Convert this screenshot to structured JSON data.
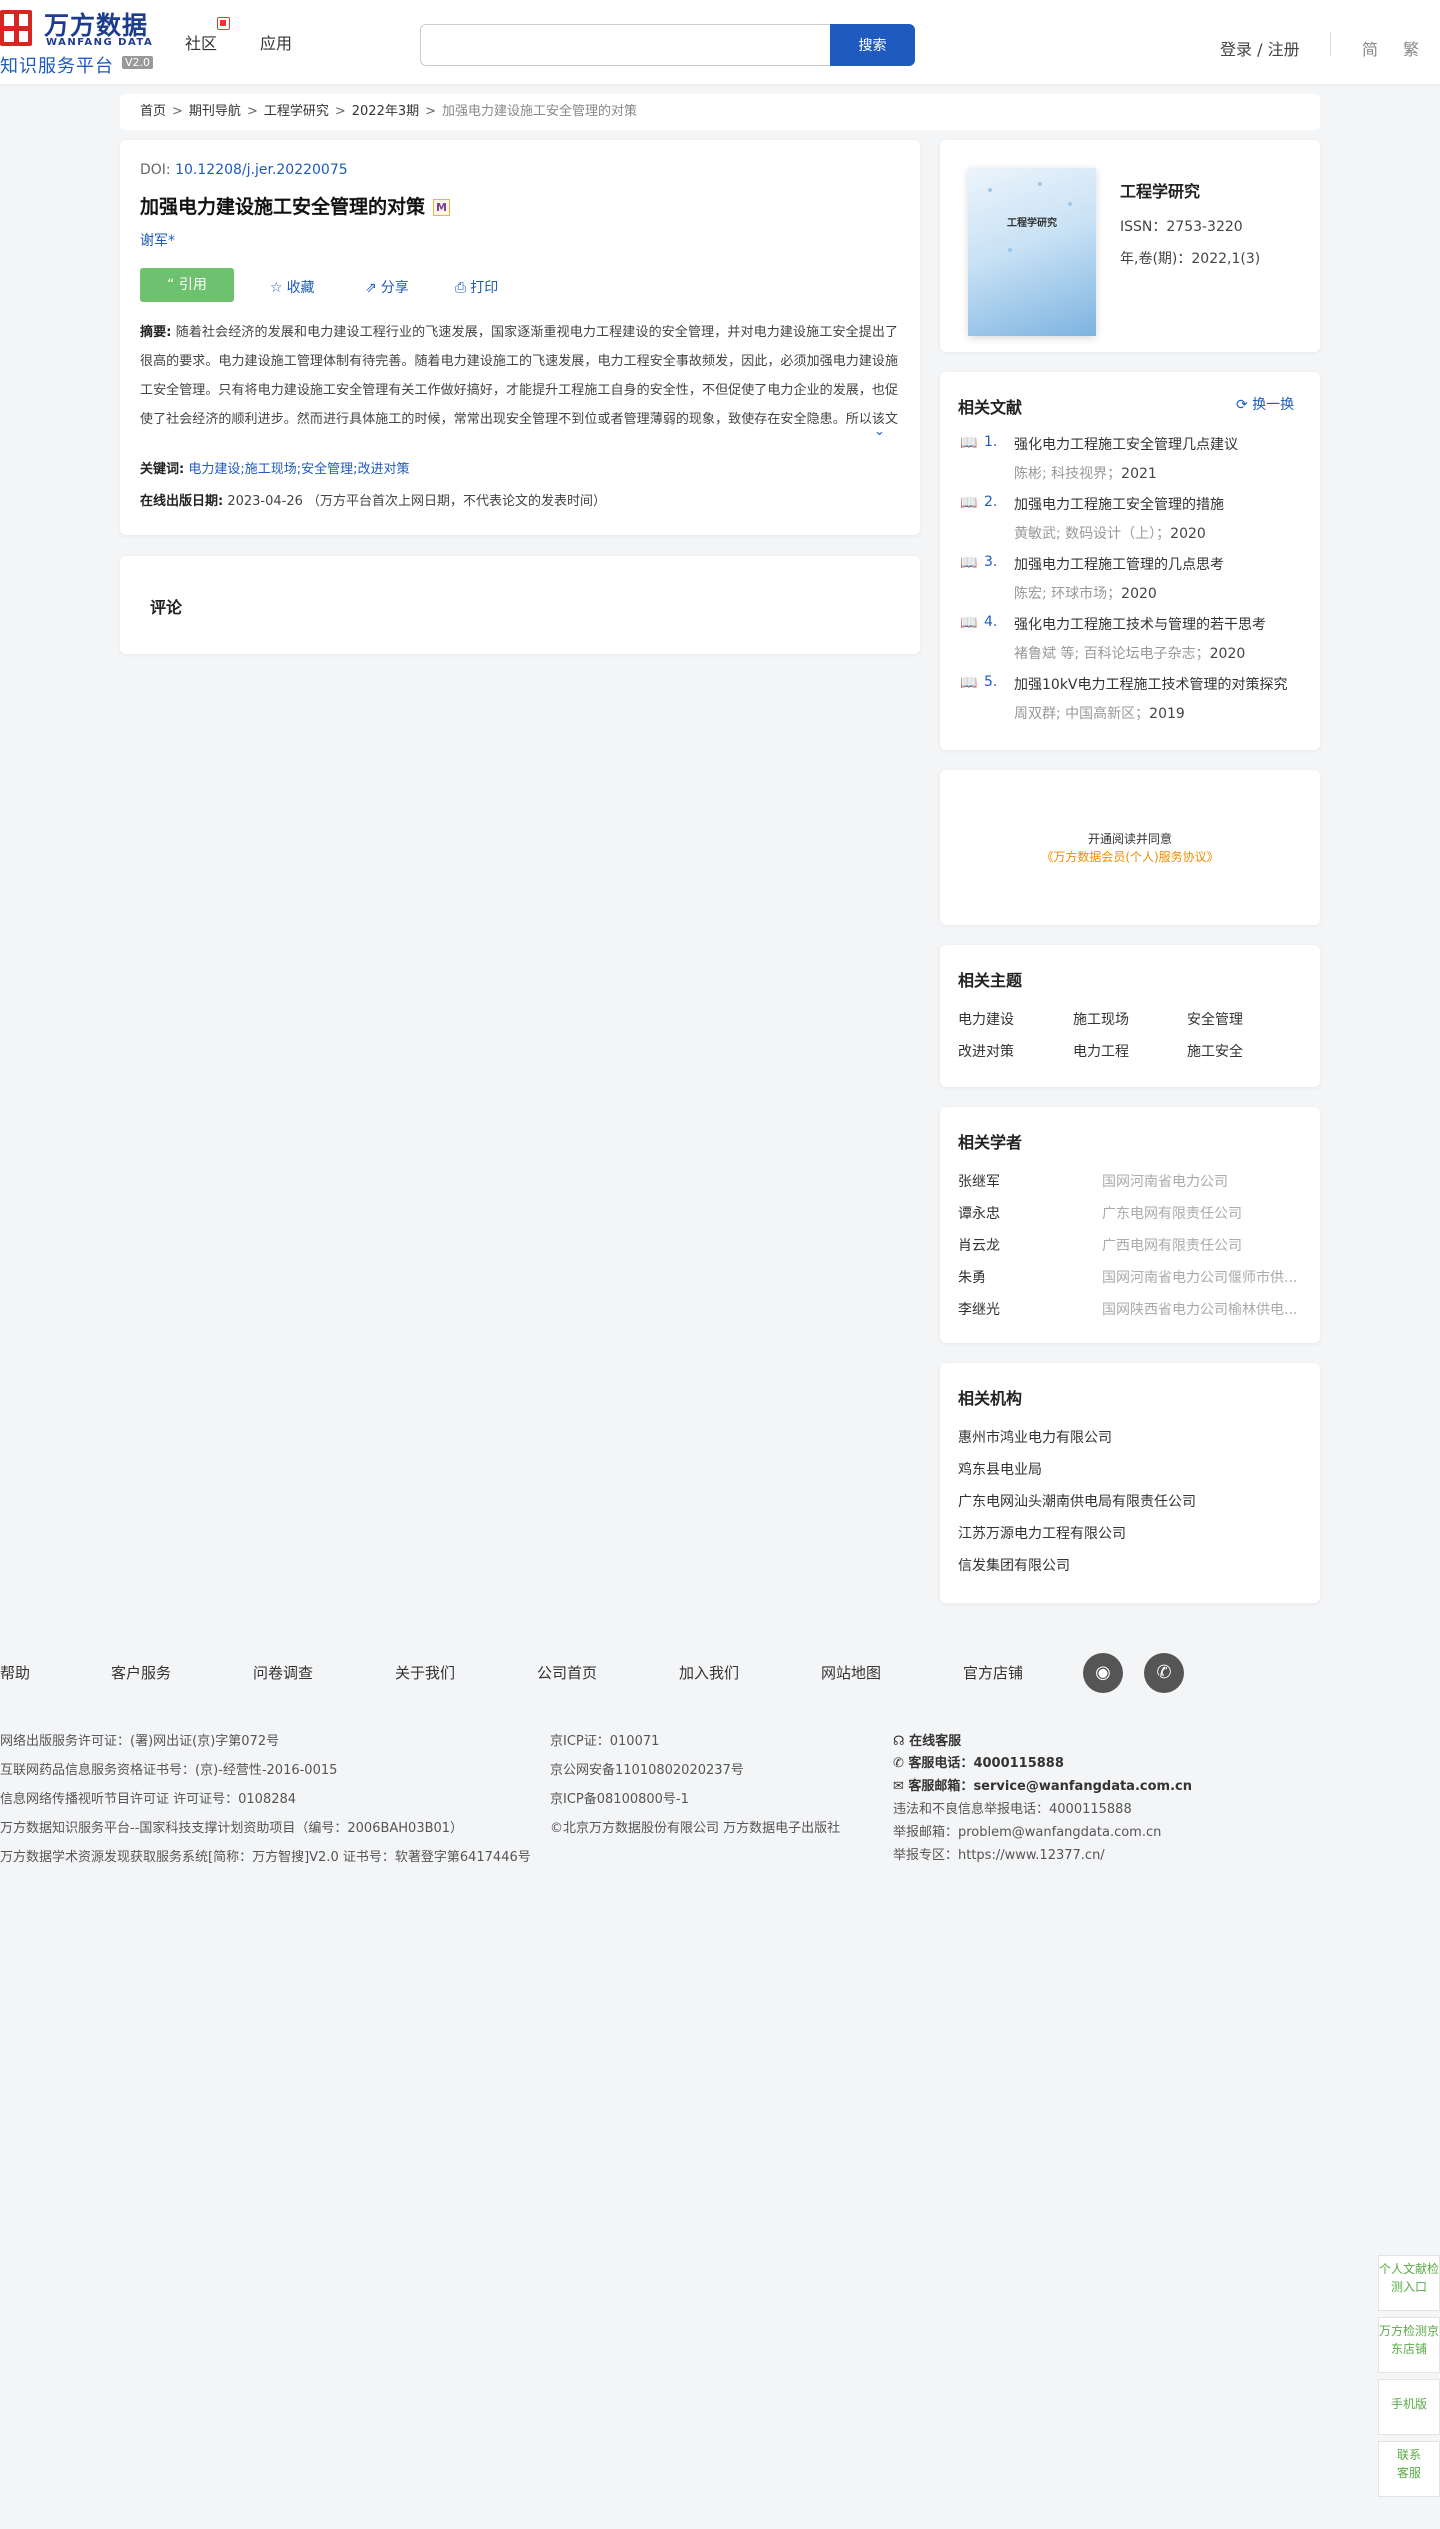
{
  "header": {
    "logo_cn": "万方数据",
    "logo_en": "WANFANG DATA",
    "logo_sub": "知识服务平台",
    "logo_version": "V2.0",
    "nav": [
      "社区",
      "应用"
    ],
    "search_placeholder": "",
    "search_button": "搜索",
    "login": "登录 / 注册",
    "lang_simplified": "简",
    "lang_traditional": "繁"
  },
  "breadcrumb": [
    "首页",
    "期刊导航",
    "工程学研究",
    "2022年3期"
  ],
  "breadcrumb_current": "加强电力建设施工安全管理的对策",
  "article": {
    "doi_label": "DOI: ",
    "doi_value": "10.12208/j.jer.20220075",
    "title": "加强电力建设施工安全管理的对策",
    "m_badge": "M",
    "author": "谢军*",
    "cite": "引用",
    "favorite": "收藏",
    "share": "分享",
    "print": "打印",
    "abstract_label": "摘要:",
    "abstract_text": "随着社会经济的发展和电力建设工程行业的飞速发展，国家逐渐重视电力工程建设的安全管理，并对电力建设施工安全提出了很高的要求。电力建设施工管理体制有待完善。随着电力建设施工的飞速发展，电力工程安全事故频发，因此，必须加强电力建设施工安全管理。只有将电力建设施工安全管理有关工作做好搞好，才能提升工程施工自身的安全性，不但促使了电力企业的发展，也促使了社会经济的顺利进步。然而进行具体施工的时候，常常出现安全管理不到位或者管理薄弱的现象，致使存在安全隐患。所以该文作者探讨出了电力建设施工安全管理薄弱现象问题的原因，随之给出了合理的改进...",
    "keywords_label": "关键词:",
    "keywords": [
      "电力建设;",
      "施工现场;",
      "安全管理;",
      "改进对策"
    ],
    "online_label": "在线出版日期:",
    "online_value": "2023-04-26 （万方平台首次上网日期，不代表论文的发表时间）"
  },
  "comments": {
    "title": "评论"
  },
  "journal": {
    "cover_title": "工程学研究",
    "name": "工程学研究",
    "issn": "ISSN：2753-3220",
    "volume": "年,卷(期)：2022,1(3)"
  },
  "related": {
    "title": "相关文献",
    "refresh": "换一换",
    "items": [
      {
        "num": "1.",
        "title": "强化电力工程施工安全管理几点建议",
        "meta": "陈彬; 科技视界；",
        "year": "2021"
      },
      {
        "num": "2.",
        "title": "加强电力工程施工安全管理的措施",
        "meta": "黄敏武; 数码设计（上）；",
        "year": "2020"
      },
      {
        "num": "3.",
        "title": "加强电力工程施工管理的几点思考",
        "meta": "陈宏; 环球市场；",
        "year": "2020"
      },
      {
        "num": "4.",
        "title": "强化电力工程施工技术与管理的若干思考",
        "meta": "褚鲁斌  等;  百科论坛电子杂志；",
        "year": "2020"
      },
      {
        "num": "5.",
        "title": "加强10kV电力工程施工技术管理的对策探究",
        "meta": "周双群; 中国高新区；",
        "year": "2019"
      }
    ]
  },
  "vip": {
    "line1": "开通阅读并同意",
    "line2": "《万方数据会员(个人)服务协议》"
  },
  "themes": {
    "title": "相关主题",
    "items": [
      "电力建设",
      "施工现场",
      "安全管理",
      "改进对策",
      "电力工程",
      "施工安全"
    ]
  },
  "scholars": {
    "title": "相关学者",
    "items": [
      {
        "name": "张继军",
        "org": "国网河南省电力公司"
      },
      {
        "name": "谭永忠",
        "org": "广东电网有限责任公司"
      },
      {
        "name": "肖云龙",
        "org": "广西电网有限责任公司"
      },
      {
        "name": "朱勇",
        "org": "国网河南省电力公司偃师市供..."
      },
      {
        "name": "李继光",
        "org": "国网陕西省电力公司榆林供电..."
      }
    ]
  },
  "institutions": {
    "title": "相关机构",
    "items": [
      "惠州市鸿业电力有限公司",
      "鸡东县电业局",
      "广东电网汕头潮南供电局有限责任公司",
      "江苏万源电力工程有限公司",
      "信发集团有限公司"
    ]
  },
  "footer": {
    "links": [
      "帮助",
      "客户服务",
      "问卷调查",
      "关于我们",
      "公司首页",
      "加入我们",
      "网站地图",
      "官方店铺"
    ],
    "col1": [
      "网络出版服务许可证：(署)网出证(京)字第072号",
      "互联网药品信息服务资格证书号：(京)-经营性-2016-0015",
      "信息网络传播视听节目许可证 许可证号：0108284",
      "万方数据知识服务平台--国家科技支撑计划资助项目（编号：2006BAH03B01）",
      "万方数据学术资源发现获取服务系统[简称：万方智搜]V2.0 证书号：软著登字第6417446号"
    ],
    "col2": [
      "京ICP证：010071",
      "京公网安备11010802020237号",
      "京ICP备08100800号-1",
      "©北京万方数据股份有限公司 万方数据电子出版社"
    ],
    "online_service": "在线客服",
    "phone_label": "客服电话：",
    "phone": "4000115888",
    "email_label": "客服邮箱：",
    "email": "service@wanfangdata.com.cn",
    "report_phone": "违法和不良信息举报电话：4000115888",
    "report_email": "举报邮箱：problem@wanfangdata.com.cn",
    "report_site": "举报专区：https://www.12377.cn/"
  },
  "side_tools": [
    "个人文献检测入口",
    "万方检测京东店铺",
    "手机版",
    "联系客服"
  ]
}
